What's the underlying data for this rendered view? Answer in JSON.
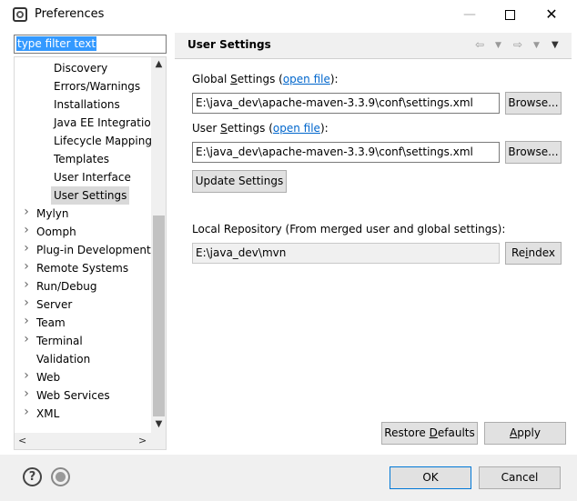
{
  "window": {
    "title": "Preferences"
  },
  "filter": {
    "value": "type filter text"
  },
  "tree": {
    "items": [
      {
        "label": "Discovery",
        "indent": 2,
        "twisty": ""
      },
      {
        "label": "Errors/Warnings",
        "indent": 2,
        "twisty": ""
      },
      {
        "label": "Installations",
        "indent": 2,
        "twisty": ""
      },
      {
        "label": "Java EE Integration",
        "indent": 2,
        "twisty": ""
      },
      {
        "label": "Lifecycle Mapping",
        "indent": 2,
        "twisty": ""
      },
      {
        "label": "Templates",
        "indent": 2,
        "twisty": ""
      },
      {
        "label": "User Interface",
        "indent": 2,
        "twisty": ""
      },
      {
        "label": "User Settings",
        "indent": 2,
        "twisty": "",
        "selected": true
      },
      {
        "label": "Mylyn",
        "indent": 1,
        "twisty": ">"
      },
      {
        "label": "Oomph",
        "indent": 1,
        "twisty": ">"
      },
      {
        "label": "Plug-in Development",
        "indent": 1,
        "twisty": ">"
      },
      {
        "label": "Remote Systems",
        "indent": 1,
        "twisty": ">"
      },
      {
        "label": "Run/Debug",
        "indent": 1,
        "twisty": ">"
      },
      {
        "label": "Server",
        "indent": 1,
        "twisty": ">"
      },
      {
        "label": "Team",
        "indent": 1,
        "twisty": ">"
      },
      {
        "label": "Terminal",
        "indent": 1,
        "twisty": ">"
      },
      {
        "label": "Validation",
        "indent": 1,
        "twisty": ""
      },
      {
        "label": "Web",
        "indent": 1,
        "twisty": ">"
      },
      {
        "label": "Web Services",
        "indent": 1,
        "twisty": ">"
      },
      {
        "label": "XML",
        "indent": 1,
        "twisty": ">"
      }
    ]
  },
  "page": {
    "title": "User Settings",
    "global_settings": {
      "label_prefix": "Global ",
      "label_mnemonic": "S",
      "label_rest": "ettings (",
      "link": "open file",
      "label_suffix": "):",
      "value": "E:\\java_dev\\apache-maven-3.3.9\\conf\\settings.xml",
      "browse": "Browse..."
    },
    "user_settings": {
      "label_prefix": "User ",
      "label_mnemonic": "S",
      "label_rest": "ettings (",
      "link": "open file",
      "label_suffix": "):",
      "value": "E:\\java_dev\\apache-maven-3.3.9\\conf\\settings.xml",
      "browse": "Browse..."
    },
    "update_settings": "Update Settings",
    "local_repo": {
      "label": "Local Repository (From merged user and global settings):",
      "value": "E:\\java_dev\\mvn",
      "reindex_prefix": "Re",
      "reindex_mnemonic": "i",
      "reindex_suffix": "ndex"
    },
    "restore_defaults_prefix": "Restore ",
    "restore_defaults_mnemonic": "D",
    "restore_defaults_suffix": "efaults",
    "apply_mnemonic": "A",
    "apply_rest": "pply"
  },
  "footer": {
    "ok": "OK",
    "cancel": "Cancel"
  },
  "icons": {
    "help": "help-icon",
    "record": "record-macro-icon",
    "back": "back-arrow-icon",
    "forward": "forward-arrow-icon",
    "menu": "view-menu-icon"
  }
}
